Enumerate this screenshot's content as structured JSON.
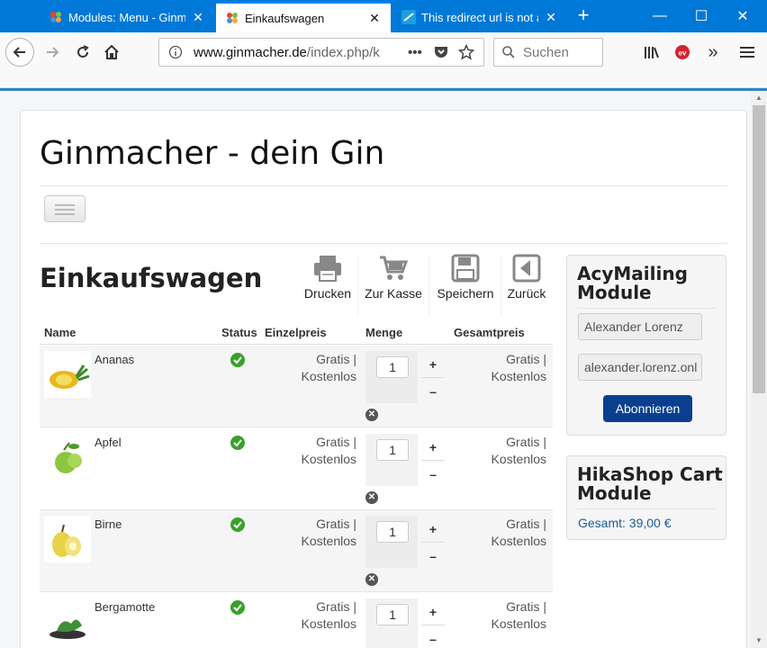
{
  "browser": {
    "tabs": [
      {
        "label": "Modules: Menu - Ginma",
        "active": false
      },
      {
        "label": "Einkaufswagen",
        "active": true
      },
      {
        "label": "This redirect url is not al",
        "active": false
      }
    ],
    "url_domain": "www.ginmacher.de",
    "url_path": "/index.php/k",
    "search_placeholder": "Suchen",
    "more": "•••"
  },
  "site": {
    "title": "Ginmacher - dein Gin"
  },
  "cart": {
    "title": "Einkaufswagen",
    "toolbar": {
      "print": "Drucken",
      "checkout": "Zur Kasse",
      "save": "Speichern",
      "back": "Zurück"
    },
    "columns": {
      "name": "Name",
      "status": "Status",
      "unit_price": "Einzelpreis",
      "quantity": "Menge",
      "total_price": "Gesamtpreis"
    },
    "items": [
      {
        "name": "Ananas",
        "price_line1": "Gratis |",
        "price_line2": "Kostenlos",
        "qty": "1",
        "total_line1": "Gratis |",
        "total_line2": "Kostenlos"
      },
      {
        "name": "Apfel",
        "price_line1": "Gratis |",
        "price_line2": "Kostenlos",
        "qty": "1",
        "total_line1": "Gratis |",
        "total_line2": "Kostenlos"
      },
      {
        "name": "Birne",
        "price_line1": "Gratis |",
        "price_line2": "Kostenlos",
        "qty": "1",
        "total_line1": "Gratis |",
        "total_line2": "Kostenlos"
      },
      {
        "name": "Bergamotte",
        "price_line1": "Gratis |",
        "price_line2": "Kostenlos",
        "qty": "1",
        "total_line1": "Gratis |",
        "total_line2": "Kostenlos"
      }
    ],
    "plus": "+",
    "minus": "–",
    "remove": "✕"
  },
  "acymailing": {
    "title_line1": "AcyMailing",
    "title_line2": "Module",
    "name_value": "Alexander Lorenz",
    "email_value": "alexander.lorenz.onl",
    "subscribe_label": "Abonnieren"
  },
  "hikashop": {
    "title_line1": "HikaShop Cart",
    "title_line2": "Module",
    "total": "Gesamt: 39,00 €"
  },
  "colors": {
    "tabbar": "#0078d7",
    "status_ok": "#3aa02c",
    "subscribe": "#0a3f8f",
    "link": "#1e5c96"
  }
}
